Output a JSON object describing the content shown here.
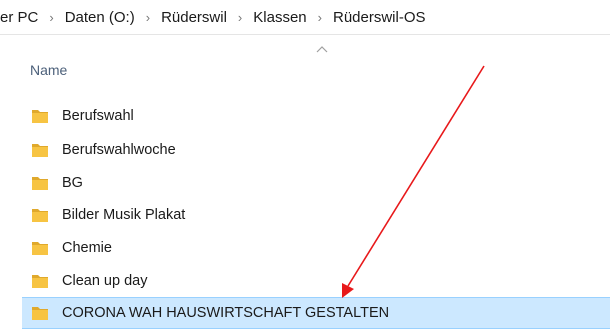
{
  "breadcrumb": {
    "items": [
      "er PC",
      "Daten (O:)",
      "Rüderswil",
      "Klassen",
      "Rüderswil-OS"
    ],
    "separator": "›"
  },
  "columns": {
    "name": "Name",
    "sort": "ascending"
  },
  "folders": [
    {
      "label": "Berufswahl",
      "selected": false
    },
    {
      "label": "Berufswahlwoche",
      "selected": false
    },
    {
      "label": "BG",
      "selected": false
    },
    {
      "label": "Bilder Musik Plakat",
      "selected": false
    },
    {
      "label": "Chemie",
      "selected": false
    },
    {
      "label": "Clean up day",
      "selected": false
    },
    {
      "label": "CORONA WAH HAUSWIRTSCHAFT GESTALTEN",
      "selected": true
    }
  ],
  "colors": {
    "folder": "#f7c443",
    "folder_back": "#e0a92c",
    "selection": "#cce8ff",
    "annotation_arrow": "#e8191b"
  }
}
